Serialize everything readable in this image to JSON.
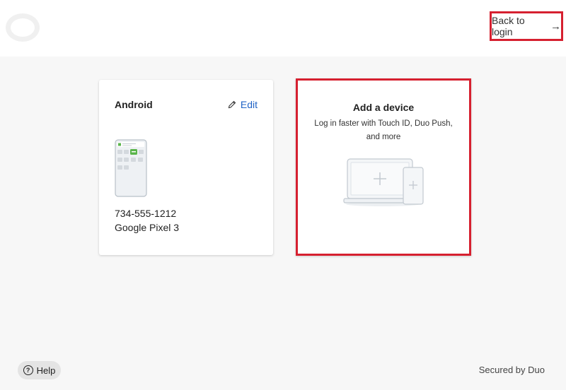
{
  "header": {
    "logo_icon": "duo-logo-icon",
    "back_to_login_label": "Back to login",
    "back_arrow": "→"
  },
  "device_card": {
    "title": "Android",
    "edit_label": "Edit",
    "phone_number": "734-555-1212",
    "phone_model": "Google Pixel 3",
    "phone_icon": "android-phone-illustration"
  },
  "add_device_card": {
    "title": "Add a device",
    "description": "Log in faster with Touch ID, Duo Push, and more",
    "illustration_icon": "laptop-and-phone-add-illustration"
  },
  "footer": {
    "help_label": "Help",
    "help_icon_glyph": "?",
    "secured_label": "Secured by Duo"
  },
  "colors": {
    "highlight_border": "#d62030",
    "link_blue": "#1f63c6",
    "page_background": "#f7f7f7",
    "accent_green": "#5ab54b"
  }
}
